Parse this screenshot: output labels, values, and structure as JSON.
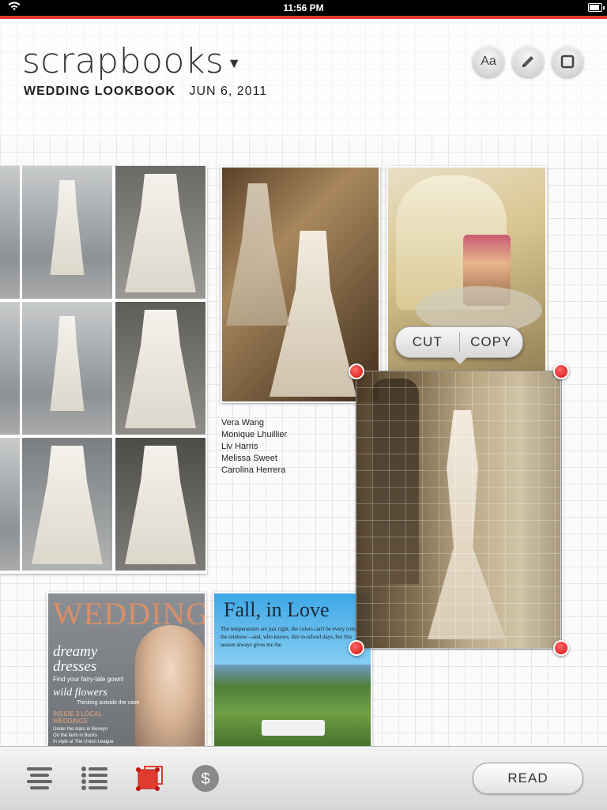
{
  "status_bar": {
    "time": "11:56 PM"
  },
  "header": {
    "app_title": "scrapbooks",
    "book_name": "WEDDING LOOKBOOK",
    "date": "JUN 6, 2011",
    "tools": [
      {
        "label": "Aa",
        "icon": "text-icon"
      },
      {
        "icon": "pencil-icon"
      },
      {
        "icon": "frame-icon"
      }
    ]
  },
  "canvas": {
    "designers_note": [
      "Vera Wang",
      "Monique Lhuillier",
      "Liv Harris",
      "Melissa Sweet",
      "Carolina Herrera"
    ],
    "magazine": {
      "masthead": "WEDDING",
      "headline_1": "dreamy",
      "headline_2": "dresses",
      "tagline": "Find your fairy-tale gown!",
      "feature": "wild flowers",
      "feature_sub": "Thinking outside the vase",
      "side_title": "INSIDE 3 LOCAL WEDDINGS",
      "side_items": [
        "Under the stars in Berwyn",
        "On the farm in Bucks",
        "In style at The Union League"
      ]
    },
    "article": {
      "title": "Fall, in Love",
      "body": "The temperatures are just right, the colors can't be every color of the rainbow—and, who knows, this to-school days, but this season always gives me the"
    },
    "context_menu": {
      "cut": "CUT",
      "copy": "COPY"
    }
  },
  "toolbar": {
    "read_label": "READ",
    "icons": [
      "paragraph-icon",
      "list-icon",
      "clipping-icon",
      "dollar-icon"
    ]
  },
  "colors": {
    "accent_red": "#e13a2e",
    "handle_red": "#d40d0d"
  }
}
